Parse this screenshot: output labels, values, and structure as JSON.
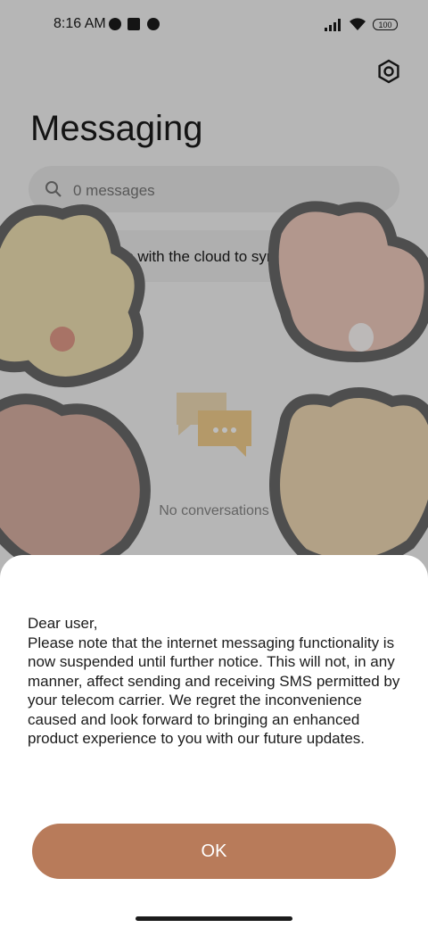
{
  "status_bar": {
    "time": "8:16 AM",
    "battery": "100"
  },
  "header": {
    "title": "Messaging",
    "settings_icon": "gear-icon"
  },
  "search": {
    "placeholder": "0 messages",
    "icon": "search-icon"
  },
  "sync_banner": {
    "text": "Turn on sync with the cloud to sync messages",
    "icon": "chevron-right-icon"
  },
  "empty_state": {
    "text": "No conversations"
  },
  "dialog": {
    "message": "Dear user,\nPlease note that the internet messaging functionality is now suspended until further notice. This will not, in any manner, affect sending and receiving SMS permitted by your telecom carrier. We regret the inconvenience caused and look forward to bringing an enhanced product experience to you with our future updates.",
    "ok_label": "OK"
  },
  "colors": {
    "accent": "#b87b5a",
    "text": "#1b1b1b"
  }
}
